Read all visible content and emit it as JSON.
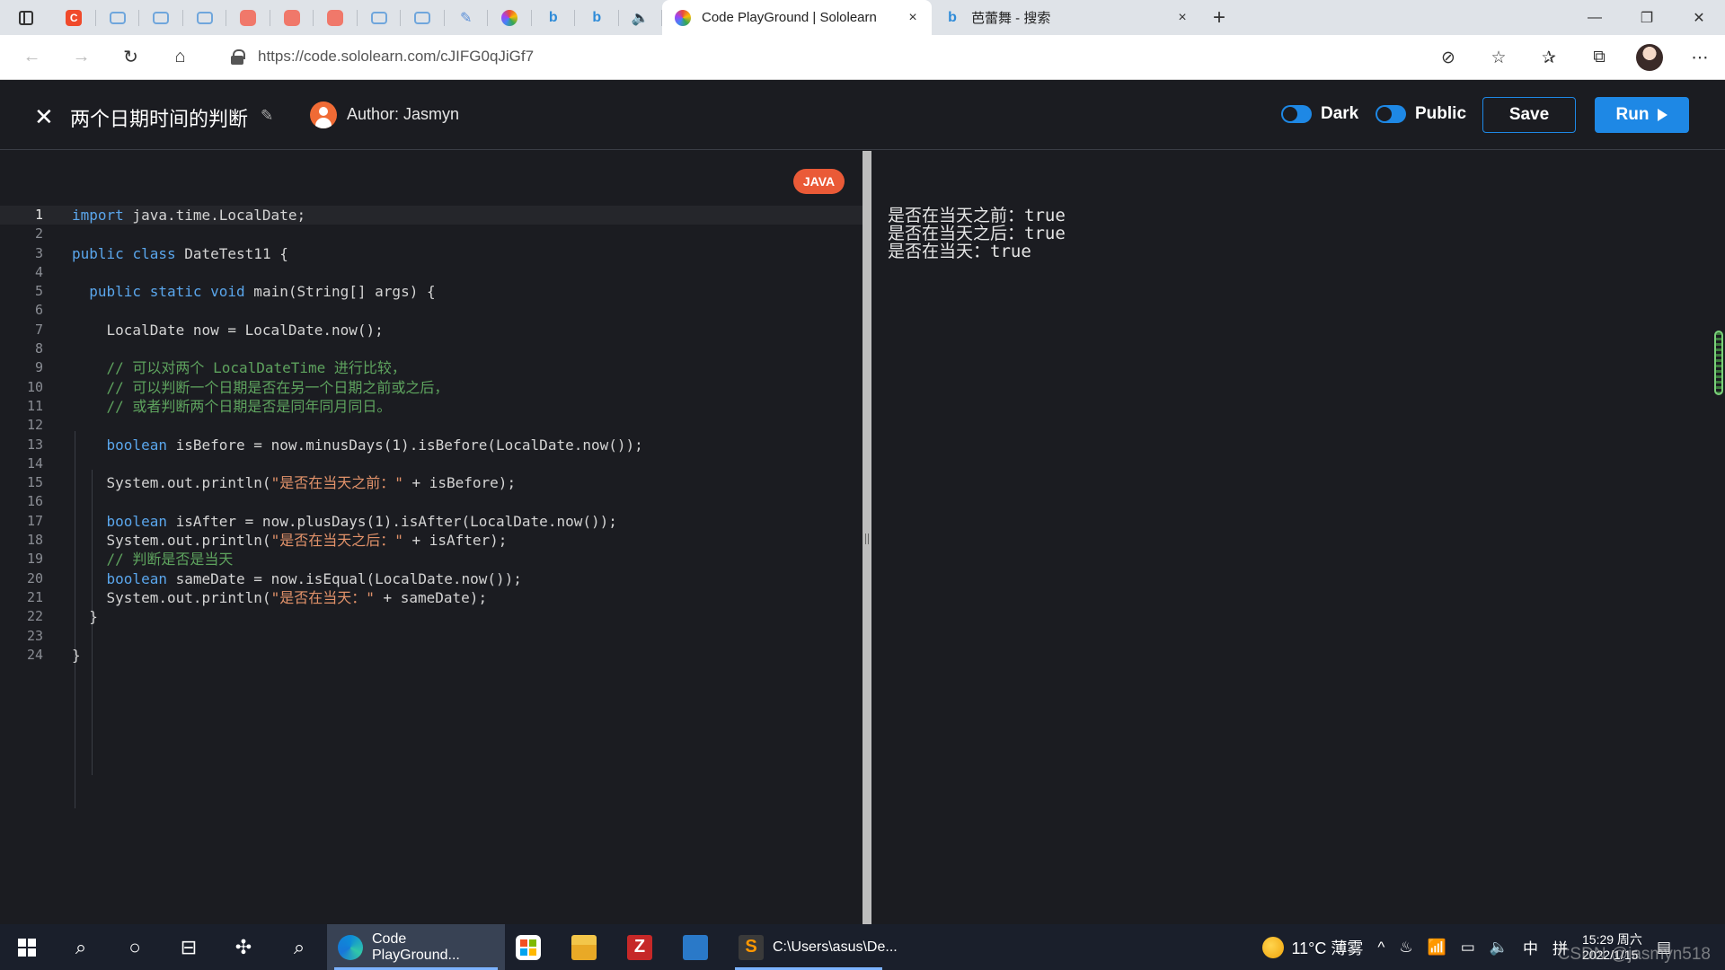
{
  "browser": {
    "active_tab": {
      "title": "Code PlayGround | Sololearn",
      "close": "×"
    },
    "second_tab": {
      "title": "芭蕾舞 - 搜索",
      "close": "×"
    },
    "new_tab": "+",
    "pinned_tabs": [
      "c-icon",
      "tv-icon",
      "tv-icon",
      "tv-icon",
      "red-icon",
      "red-icon",
      "red-icon",
      "tv-icon",
      "tv-icon",
      "pen-icon",
      "swirl-icon",
      "bing-icon",
      "bing-icon",
      "speaker-icon"
    ],
    "url": "https://code.sololearn.com/cJIFG0qJiGf7",
    "window_controls": {
      "minimize": "—",
      "restore": "❐",
      "close": "✕"
    }
  },
  "app": {
    "close_icon": "✕",
    "code_title": "两个日期时间的判断",
    "author_label": "Author: Jasmyn",
    "toggle_dark_label": "Dark",
    "toggle_public_label": "Public",
    "save_label": "Save",
    "run_label": "Run",
    "language_badge": "JAVA"
  },
  "code_lines": [
    [
      {
        "t": "kw",
        "v": "import"
      },
      {
        "t": "p",
        "v": " java.time.LocalDate;"
      }
    ],
    [],
    [
      {
        "t": "kw",
        "v": "public"
      },
      {
        "t": "p",
        "v": " "
      },
      {
        "t": "kw",
        "v": "class"
      },
      {
        "t": "p",
        "v": " DateTest11 {"
      }
    ],
    [],
    [
      {
        "t": "p",
        "v": "  "
      },
      {
        "t": "kw",
        "v": "public"
      },
      {
        "t": "p",
        "v": " "
      },
      {
        "t": "kw",
        "v": "static"
      },
      {
        "t": "p",
        "v": " "
      },
      {
        "t": "kw",
        "v": "void"
      },
      {
        "t": "p",
        "v": " main(String[] args) {"
      }
    ],
    [],
    [
      {
        "t": "p",
        "v": "    LocalDate now = LocalDate.now();"
      }
    ],
    [],
    [
      {
        "t": "cm",
        "v": "    // 可以对两个 LocalDateTime 进行比较，"
      }
    ],
    [
      {
        "t": "cm",
        "v": "    // 可以判断一个日期是否在另一个日期之前或之后，"
      }
    ],
    [
      {
        "t": "cm",
        "v": "    // 或者判断两个日期是否是同年同月同日。"
      }
    ],
    [],
    [
      {
        "t": "p",
        "v": "    "
      },
      {
        "t": "kw",
        "v": "boolean"
      },
      {
        "t": "p",
        "v": " isBefore = now.minusDays(1).isBefore(LocalDate.now());"
      }
    ],
    [],
    [
      {
        "t": "p",
        "v": "    System.out.println("
      },
      {
        "t": "st",
        "v": "\"是否在当天之前：\""
      },
      {
        "t": "p",
        "v": " + isBefore);"
      }
    ],
    [],
    [
      {
        "t": "p",
        "v": "    "
      },
      {
        "t": "kw",
        "v": "boolean"
      },
      {
        "t": "p",
        "v": " isAfter = now.plusDays(1).isAfter(LocalDate.now());"
      }
    ],
    [
      {
        "t": "p",
        "v": "    System.out.println("
      },
      {
        "t": "st",
        "v": "\"是否在当天之后：\""
      },
      {
        "t": "p",
        "v": " + isAfter);"
      }
    ],
    [
      {
        "t": "cm",
        "v": "    // 判断是否是当天"
      }
    ],
    [
      {
        "t": "p",
        "v": "    "
      },
      {
        "t": "kw",
        "v": "boolean"
      },
      {
        "t": "p",
        "v": " sameDate = now.isEqual(LocalDate.now());"
      }
    ],
    [
      {
        "t": "p",
        "v": "    System.out.println("
      },
      {
        "t": "st",
        "v": "\"是否在当天：\""
      },
      {
        "t": "p",
        "v": " + sameDate);"
      }
    ],
    [
      {
        "t": "p",
        "v": "  }"
      }
    ],
    [],
    [
      {
        "t": "p",
        "v": "}"
      }
    ]
  ],
  "output_lines": [
    "是否在当天之前：true",
    "是否在当天之后：true",
    "是否在当天：true"
  ],
  "taskbar": {
    "edge_label": "Code PlayGround...",
    "sublime_label": "C:\\Users\\asus\\De...",
    "weather": "11°C 薄雾",
    "ime": "中",
    "ime2": "拼",
    "time": "15:29 周六",
    "date": "2022/1/15",
    "watermark": "CSDN @jasmyn518"
  }
}
